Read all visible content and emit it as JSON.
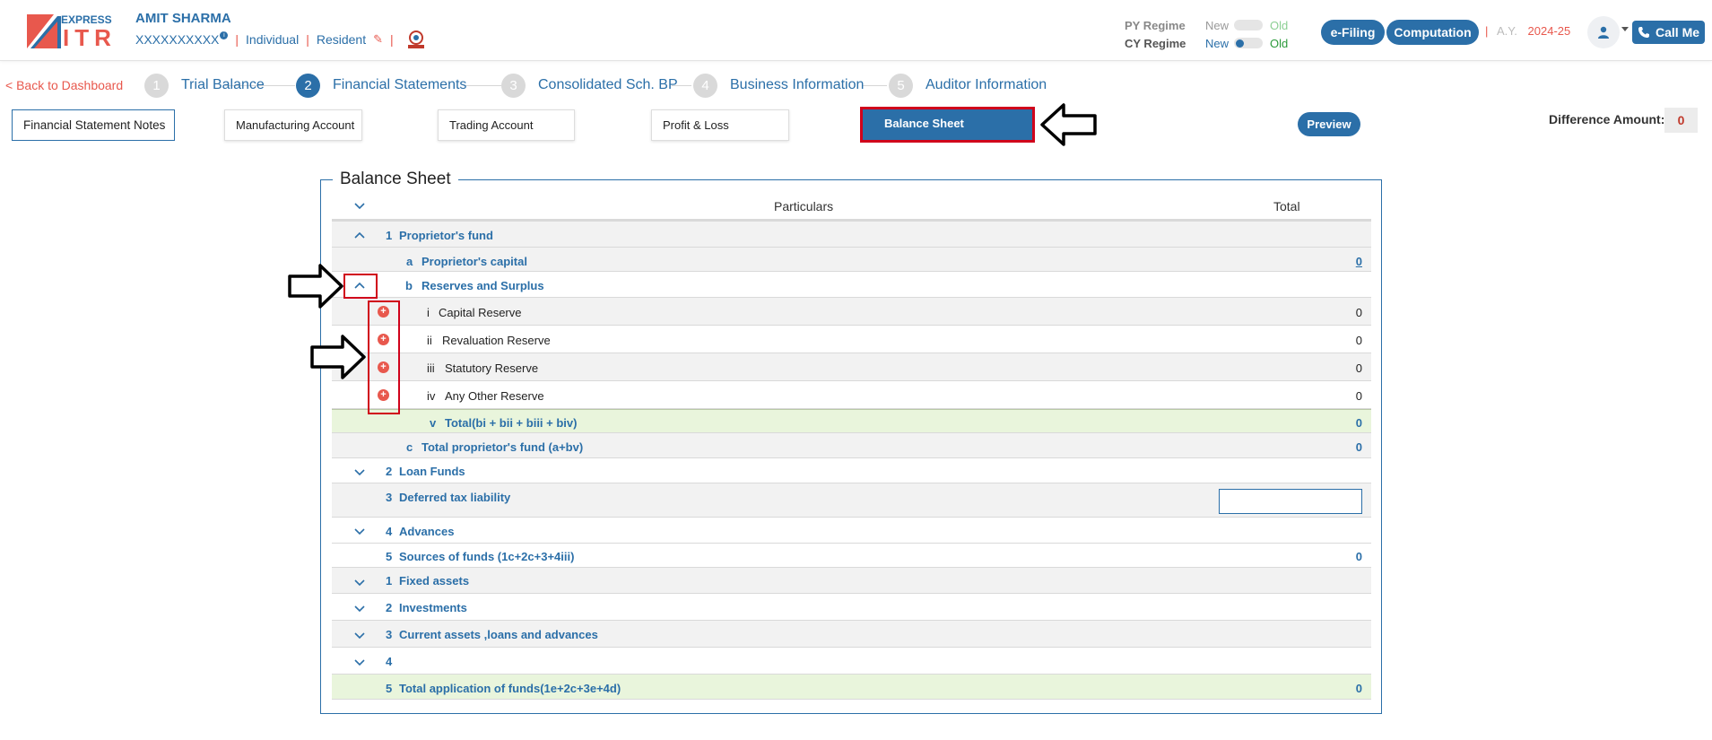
{
  "header": {
    "logo_top": "EXPRESS",
    "logo_main": "ITR",
    "user_name": "AMIT SHARMA",
    "pan": "XXXXXXXXXX",
    "status": "Individual",
    "residency": "Resident",
    "py_regime_label": "PY Regime",
    "cy_regime_label": "CY Regime",
    "new_label": "New",
    "old_label": "Old",
    "efiling_label": "e-Filing",
    "computation_label": "Computation",
    "ay_label": "A.Y.",
    "ay_value": "2024-25",
    "call_me_label": "Call Me"
  },
  "nav": {
    "back_label": "< Back to Dashboard",
    "steps": [
      {
        "num": "1",
        "label": "Trial Balance"
      },
      {
        "num": "2",
        "label": "Financial Statements"
      },
      {
        "num": "3",
        "label": "Consolidated Sch. BP"
      },
      {
        "num": "4",
        "label": "Business Information"
      },
      {
        "num": "5",
        "label": "Auditor Information"
      }
    ]
  },
  "tabs": {
    "notes": "Financial Statement Notes",
    "manufacturing": "Manufacturing Account",
    "trading": "Trading Account",
    "pl": "Profit & Loss",
    "balance_sheet": "Balance Sheet",
    "preview": "Preview",
    "difference_label": "Difference Amount:",
    "difference_value": "0"
  },
  "sheet": {
    "title": "Balance Sheet",
    "col_particulars": "Particulars",
    "col_total": "Total",
    "rows": [
      {
        "num": "1",
        "label": "Proprietor's fund",
        "value": ""
      },
      {
        "num": "a",
        "label": "Proprietor's capital",
        "value": "0"
      },
      {
        "num": "b",
        "label": "Reserves and Surplus",
        "value": ""
      },
      {
        "num": "i",
        "label": "Capital Reserve",
        "value": "0"
      },
      {
        "num": "ii",
        "label": "Revaluation Reserve",
        "value": "0"
      },
      {
        "num": "iii",
        "label": "Statutory Reserve",
        "value": "0"
      },
      {
        "num": "iv",
        "label": "Any Other Reserve",
        "value": "0"
      },
      {
        "num": "v",
        "label": "Total(bi + bii + biii + biv)",
        "value": "0"
      },
      {
        "num": "c",
        "label": "Total proprietor's fund (a+bv)",
        "value": "0"
      },
      {
        "num": "2",
        "label": "Loan Funds",
        "value": ""
      },
      {
        "num": "3",
        "label": "Deferred tax liability",
        "value": ""
      },
      {
        "num": "4",
        "label": "Advances",
        "value": ""
      },
      {
        "num": "5",
        "label": "Sources of funds (1c+2c+3+4iii)",
        "value": "0"
      },
      {
        "num": "1",
        "label": "Fixed assets",
        "value": ""
      },
      {
        "num": "2",
        "label": "Investments",
        "value": ""
      },
      {
        "num": "3",
        "label": "Current assets ,loans and advances",
        "value": ""
      },
      {
        "num": "4",
        "label": "",
        "value": ""
      },
      {
        "num": "5",
        "label": "Total application of funds(1e+2c+3e+4d)",
        "value": "0"
      }
    ]
  },
  "colors": {
    "brand_blue": "#2b6fa8",
    "accent_red": "#e8584d",
    "highlight_red": "#d0021b",
    "total_green_bg": "#e9f5dc"
  }
}
